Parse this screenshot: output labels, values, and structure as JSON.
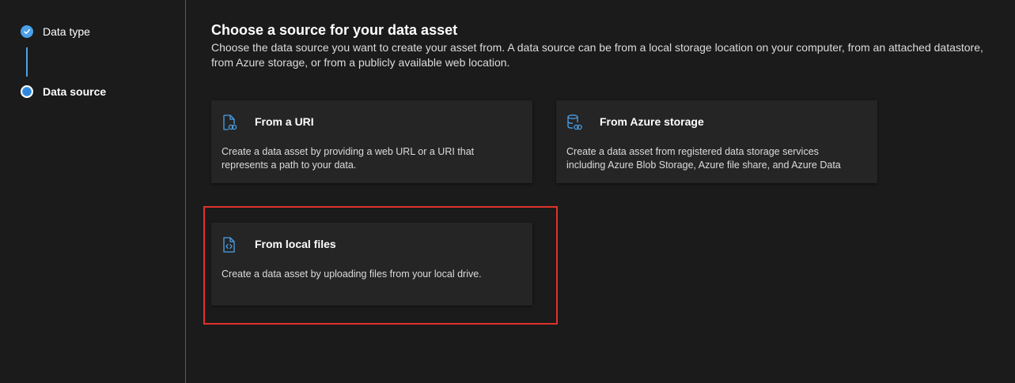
{
  "wizard": {
    "steps": [
      {
        "label": "Data type",
        "state": "completed"
      },
      {
        "label": "Data source",
        "state": "current"
      }
    ]
  },
  "main": {
    "title": "Choose a source for your data asset",
    "description": "Choose the data source you want to create your asset from. A data source can be from a local storage location on your computer, from an attached datastore, from Azure storage, or from a publicly available web location."
  },
  "cards": {
    "uri": {
      "icon": "file-link-icon",
      "title": "From a URI",
      "description": "Create a data asset by providing a web URL or a URI that represents a path to your data."
    },
    "azure": {
      "icon": "database-link-icon",
      "title": "From Azure storage",
      "description": "Create a data asset from registered data storage services including Azure Blob Storage, Azure file share, and Azure Data"
    },
    "local": {
      "icon": "file-code-icon",
      "title": "From local files",
      "description": "Create a data asset by uploading files from your local drive."
    }
  },
  "colors": {
    "background": "#1b1b1b",
    "card": "#252525",
    "accent": "#4ba0e8",
    "highlight": "#e0312b"
  }
}
